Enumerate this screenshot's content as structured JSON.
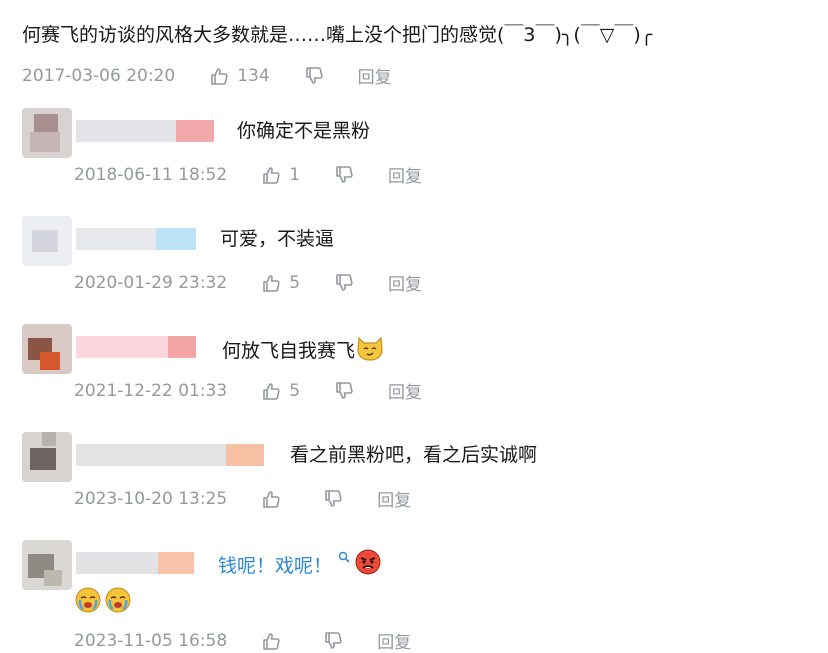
{
  "root_comment": {
    "text": "何赛飞的访谈的风格大多数就是……嘴上没个把门的感觉(￣3￣)╮(￣▽￣)╭",
    "time": "2017-03-06 20:20",
    "likes": "134",
    "reply_label": "回复"
  },
  "replies": [
    {
      "text": "你确定不是黑粉",
      "time": "2018-06-11 18:52",
      "likes": "1",
      "reply_label": "回复"
    },
    {
      "text": "可爱，不装逼",
      "time": "2020-01-29 23:32",
      "likes": "5",
      "reply_label": "回复"
    },
    {
      "text": "何放飞自我赛飞",
      "emoji": "cat-smirk-emoji",
      "time": "2021-12-22 01:33",
      "likes": "5",
      "reply_label": "回复"
    },
    {
      "text": "看之前黑粉吧，看之后实诚啊",
      "time": "2023-10-20 13:25",
      "likes": "",
      "reply_label": "回复"
    },
    {
      "text": "钱呢！戏呢！",
      "link_icon": "search-icon",
      "emoji": "angry-face-emoji",
      "extra_emojis": [
        "crying-face-emoji",
        "crying-face-emoji"
      ],
      "time": "2023-11-05 16:58",
      "likes": "",
      "reply_label": "回复"
    }
  ],
  "colors": {
    "meta": "#9499a0",
    "text": "#18191c",
    "link": "#2b8ad8"
  }
}
